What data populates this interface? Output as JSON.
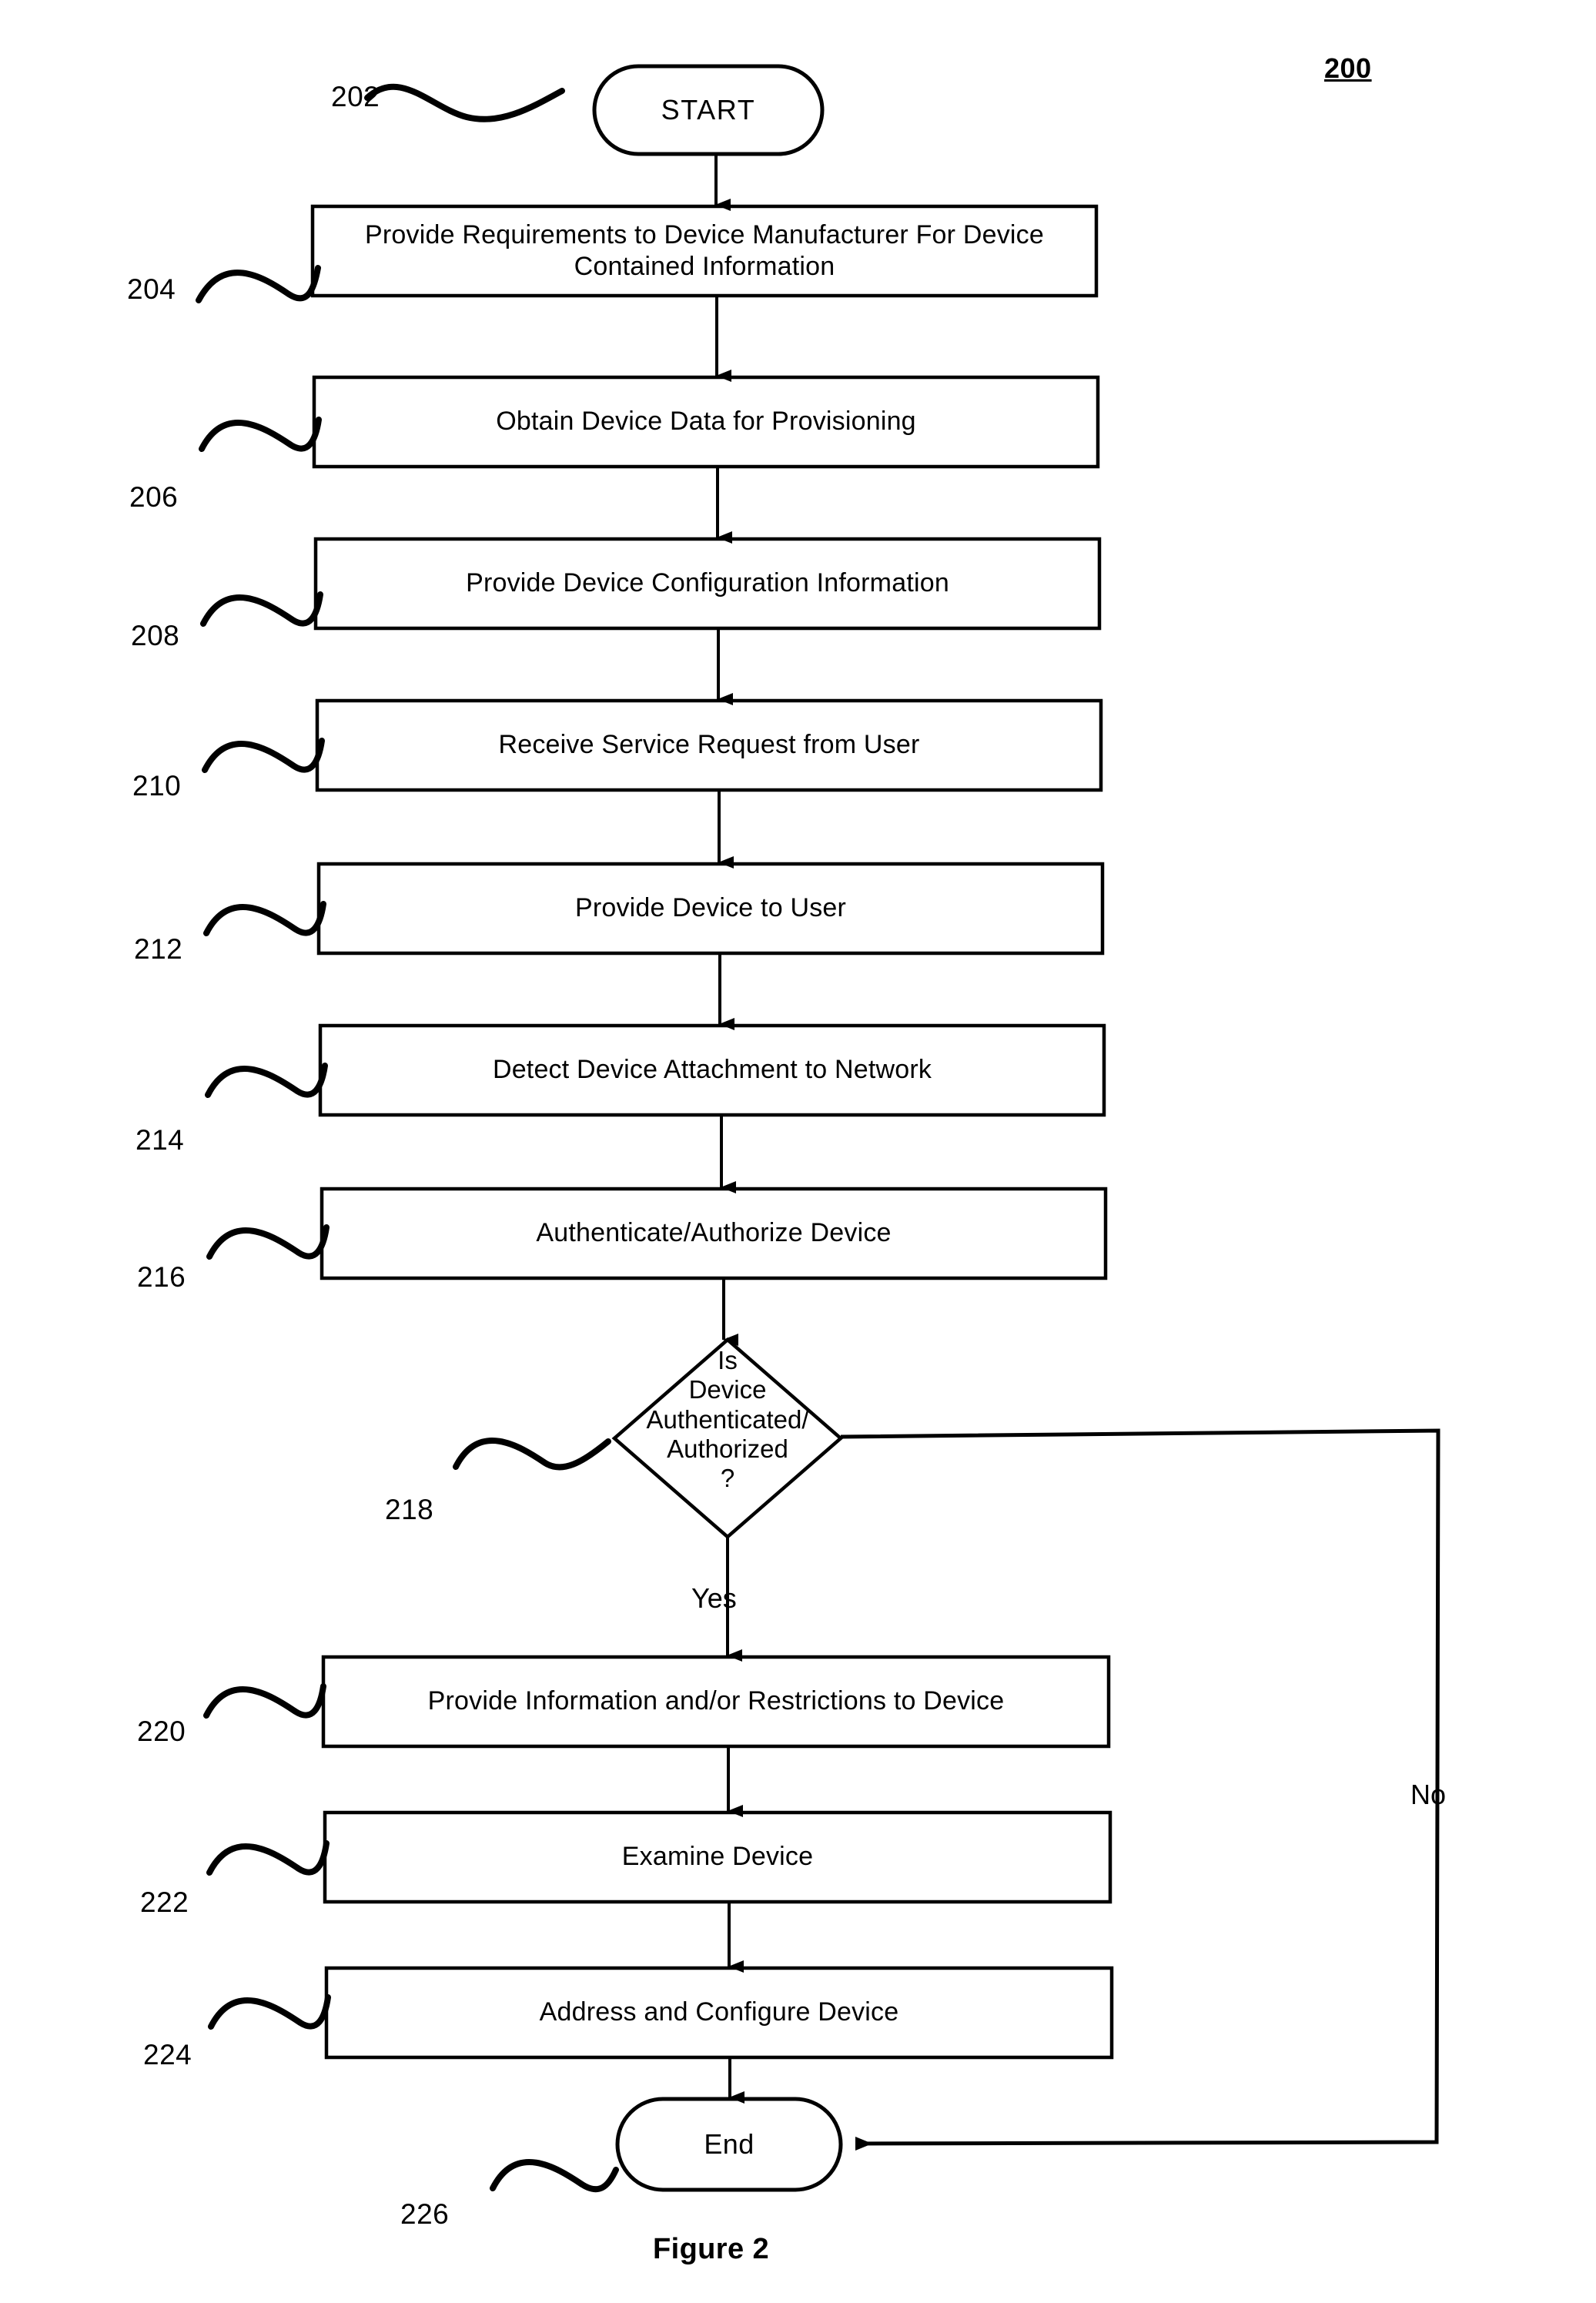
{
  "figure": {
    "id_label": "200",
    "caption": "Figure 2"
  },
  "terminals": {
    "start": {
      "ref": "202",
      "label": "START"
    },
    "end": {
      "ref": "226",
      "label": "End"
    }
  },
  "steps": [
    {
      "ref": "204",
      "label": "Provide Requirements to Device Manufacturer For Device Contained Information"
    },
    {
      "ref": "206",
      "label": "Obtain Device Data for Provisioning"
    },
    {
      "ref": "208",
      "label": "Provide Device Configuration Information"
    },
    {
      "ref": "210",
      "label": "Receive Service Request from User"
    },
    {
      "ref": "212",
      "label": "Provide Device to User"
    },
    {
      "ref": "214",
      "label": "Detect Device Attachment to Network"
    },
    {
      "ref": "216",
      "label": "Authenticate/Authorize Device"
    },
    {
      "ref": "220",
      "label": "Provide Information and/or Restrictions to Device"
    },
    {
      "ref": "222",
      "label": "Examine Device"
    },
    {
      "ref": "224",
      "label": "Address and Configure Device"
    }
  ],
  "decision": {
    "ref": "218",
    "line1": "Is",
    "line2": "Device",
    "line3": "Authenticated/",
    "line4": "Authorized",
    "line5": "?",
    "yes_label": "Yes",
    "no_label": "No"
  },
  "colors": {
    "ink": "#000000",
    "paper": "#ffffff"
  }
}
